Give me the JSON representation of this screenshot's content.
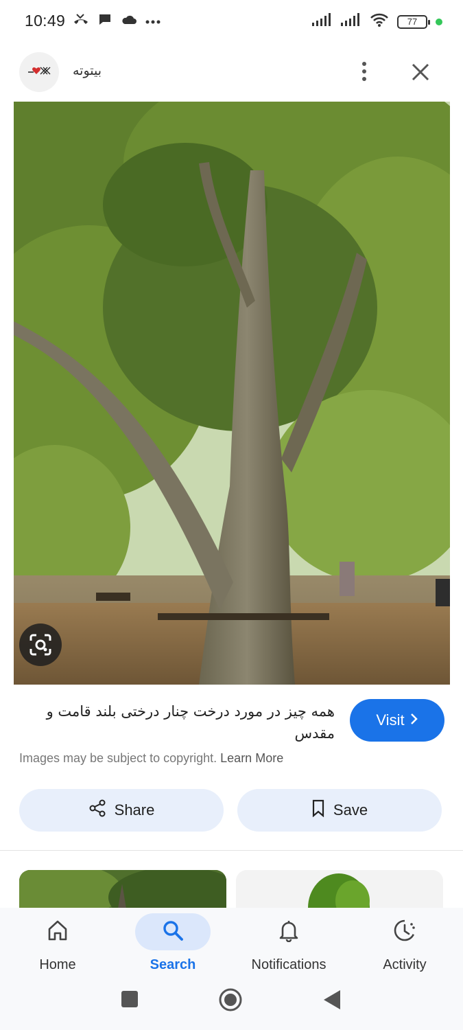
{
  "status_bar": {
    "time": "10:49",
    "battery": "77",
    "left_icons": [
      "missed-call-icon",
      "chat-bubble-icon",
      "cloud-icon",
      "more-dots-icon"
    ],
    "right_icons": [
      "signal-icon",
      "signal-icon",
      "wifi-icon",
      "battery-icon"
    ]
  },
  "header": {
    "site_name": "بیتوته",
    "menu_icon": "more-vert-icon",
    "close_icon": "close-icon"
  },
  "image": {
    "lens_icon": "lens-icon"
  },
  "result": {
    "title": "همه چیز در مورد درخت چنار درختی بلند قامت و مقدس",
    "visit_label": "Visit",
    "copyright_text": "Images may be subject to copyright.",
    "learn_more": "Learn More"
  },
  "actions": {
    "share_label": "Share",
    "save_label": "Save"
  },
  "bottom_nav": {
    "items": [
      {
        "label": "Home",
        "icon": "home-icon"
      },
      {
        "label": "Search",
        "icon": "search-icon",
        "active": true
      },
      {
        "label": "Notifications",
        "icon": "bell-icon"
      },
      {
        "label": "Activity",
        "icon": "activity-icon"
      }
    ]
  },
  "colors": {
    "accent": "#1a73e8",
    "chip_bg": "#e8effb",
    "nav_active_bg": "#dbe7fb"
  }
}
